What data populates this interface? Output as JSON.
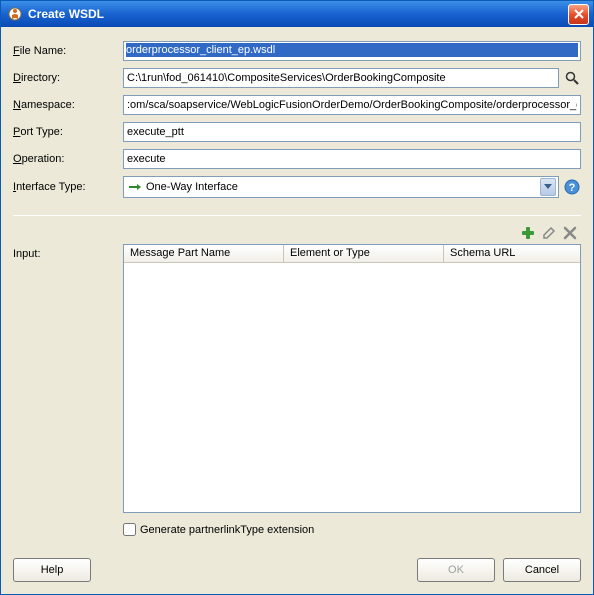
{
  "title": "Create WSDL",
  "labels": {
    "file_name": "File Name:",
    "file_name_key": "F",
    "directory": "Directory:",
    "directory_key": "D",
    "namespace": "Namespace:",
    "namespace_key": "N",
    "port_type": "Port Type:",
    "port_type_key": "P",
    "operation": "Operation:",
    "operation_key": "O",
    "interface_type": "Interface Type:",
    "interface_type_key": "I",
    "input": "Input:"
  },
  "values": {
    "file_name": "orderprocessor_client_ep.wsdl",
    "directory": "C:\\1run\\fod_061410\\CompositeServices\\OrderBookingComposite",
    "namespace": ":om/sca/soapservice/WebLogicFusionOrderDemo/OrderBookingComposite/orderprocessor_client_ep",
    "port_type": "execute_ptt",
    "operation": "execute",
    "interface_type": "One-Way Interface"
  },
  "table": {
    "cols": [
      "Message Part Name",
      "Element or Type",
      "Schema URL"
    ]
  },
  "checkbox": {
    "label": "Generate partnerlinkType extension",
    "checked": false
  },
  "buttons": {
    "help": "Help",
    "ok": "OK",
    "cancel": "Cancel"
  },
  "icons": {
    "browse": "browse",
    "help": "help",
    "add": "add",
    "edit": "edit",
    "delete": "delete"
  }
}
